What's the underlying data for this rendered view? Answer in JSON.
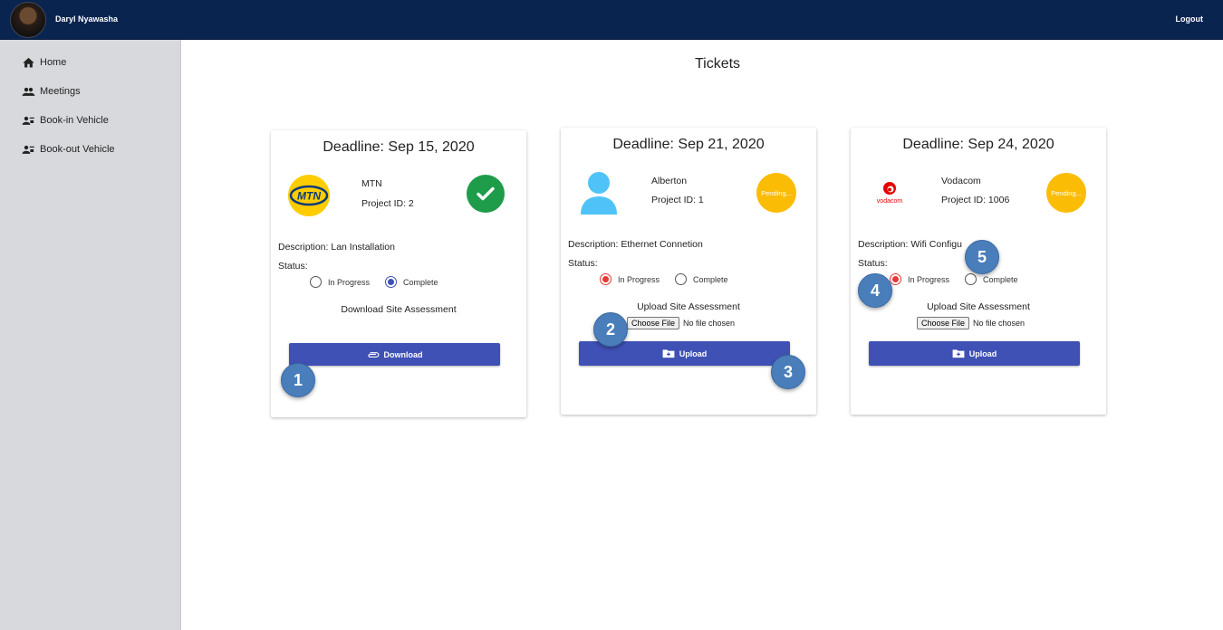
{
  "header": {
    "username": "Daryl Nyawasha",
    "logout_label": "Logout"
  },
  "sidebar": {
    "items": [
      {
        "label": "Home",
        "icon": "home-icon"
      },
      {
        "label": "Meetings",
        "icon": "people-icon"
      },
      {
        "label": "Book-in Vehicle",
        "icon": "person-vehicle-icon"
      },
      {
        "label": "Book-out Vehicle",
        "icon": "person-vehicle-icon"
      }
    ]
  },
  "main": {
    "title": "Tickets"
  },
  "cards": [
    {
      "deadline": "Deadline: Sep 15, 2020",
      "org": "MTN",
      "project": "Project ID: 2",
      "logo_text": "MTN",
      "status_badge": "complete-check-icon",
      "description": "Description: Lan Installation",
      "status_label": "Status:",
      "radio_in_progress": "In Progress",
      "radio_complete": "Complete",
      "selected": "Complete",
      "section_title": "Download Site Assessment",
      "button_label": "Download"
    },
    {
      "deadline": "Deadline: Sep 21, 2020",
      "org": "Alberton",
      "project": "Project ID: 1",
      "status_badge": "Pending...",
      "description": "Description: Ethernet Connetion",
      "status_label": "Status:",
      "radio_in_progress": "In Progress",
      "radio_complete": "Complete",
      "selected": "In Progress",
      "section_title": "Upload Site Assessment",
      "file_button": "Choose File",
      "file_status": "No file chosen",
      "button_label": "Upload"
    },
    {
      "deadline": "Deadline: Sep 24, 2020",
      "org": "Vodacom",
      "project": "Project ID: 1006",
      "logo_text": "vodacom",
      "status_badge": "Pending...",
      "description": "Description: Wifi Configu",
      "status_label": "Status:",
      "radio_in_progress": "In Progress",
      "radio_complete": "Complete",
      "selected": "In Progress",
      "section_title": "Upload Site Assessment",
      "file_button": "Choose File",
      "file_status": "No file chosen",
      "button_label": "Upload"
    }
  ],
  "markers": [
    "1",
    "2",
    "3",
    "4",
    "5"
  ],
  "colors": {
    "header": "#0a2450",
    "sidebar": "#d8d9dc",
    "primary": "#3f51b5",
    "pending": "#fbbc05",
    "complete": "#1e9c4a",
    "radio_red": "#e53935",
    "marker": "#4a7ebb"
  }
}
